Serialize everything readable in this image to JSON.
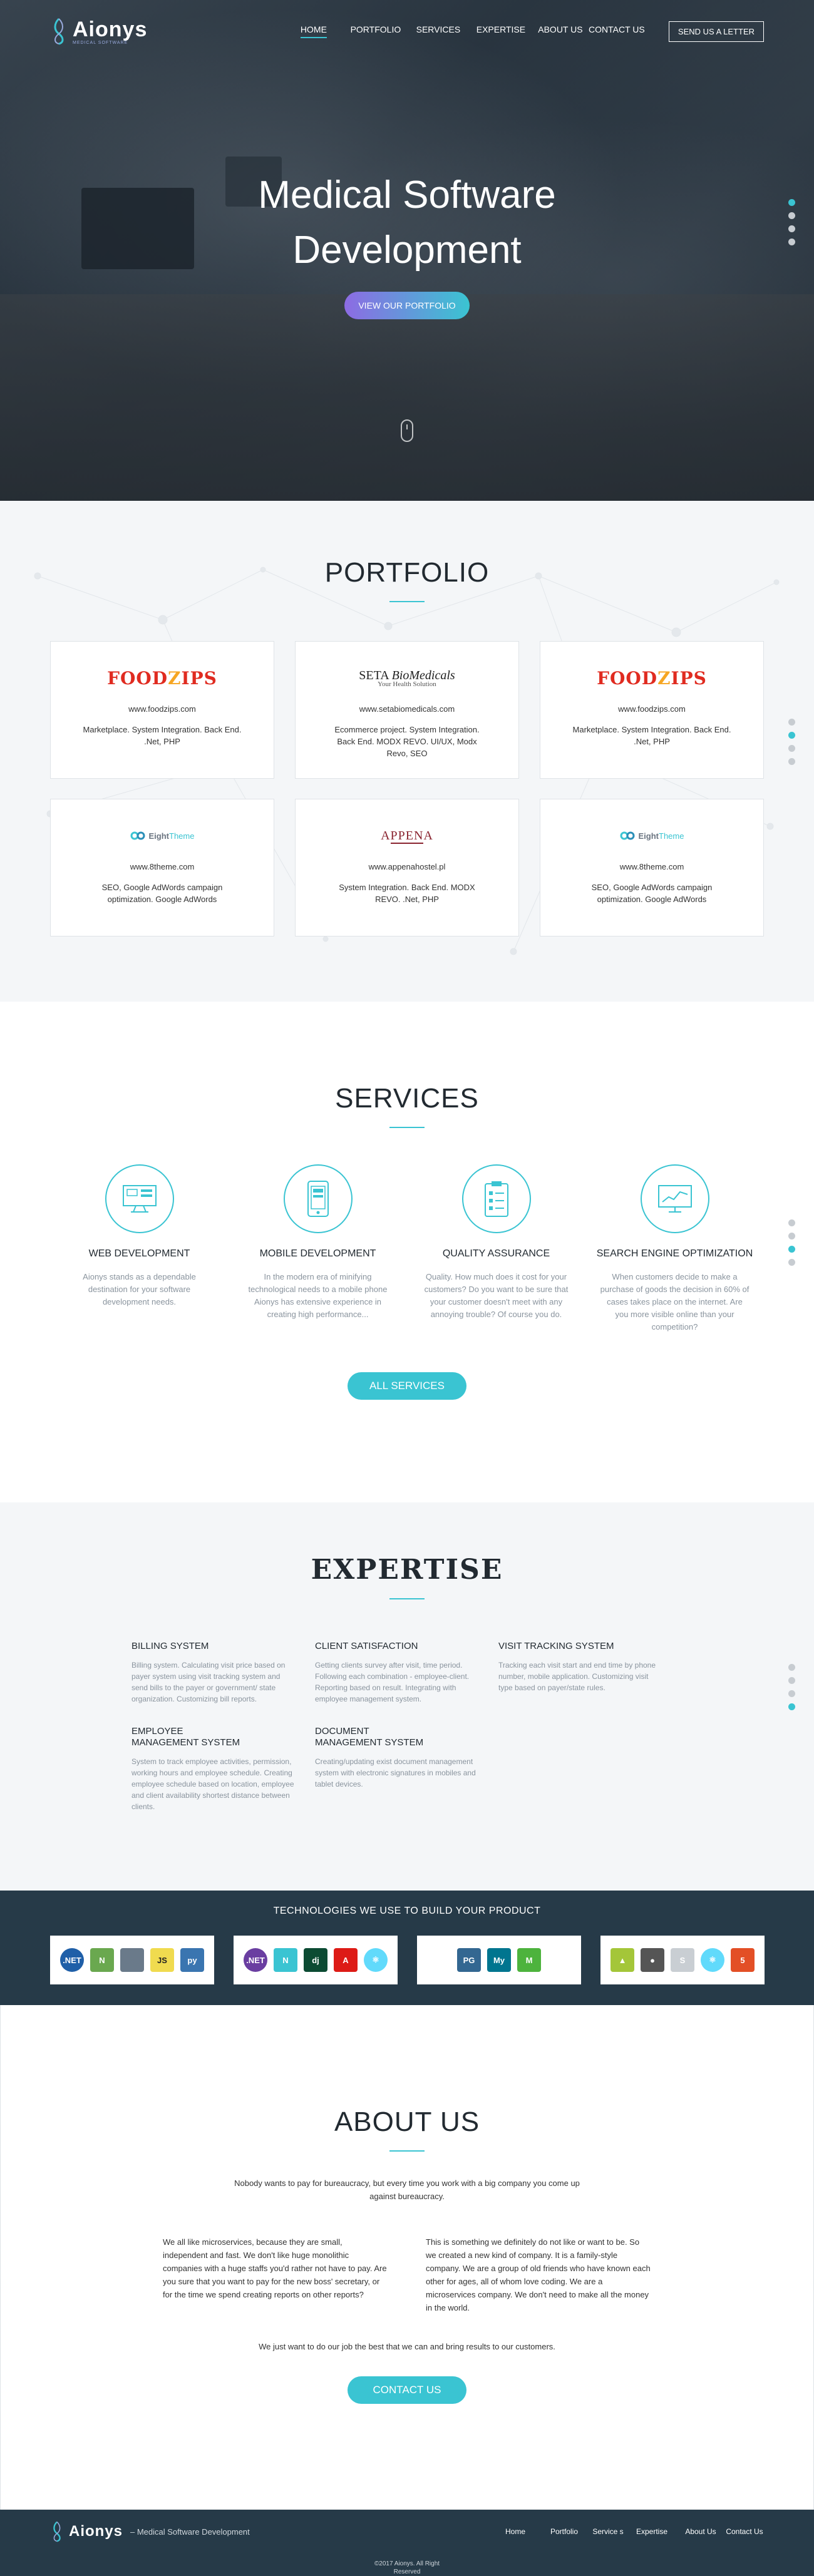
{
  "brand": {
    "name": "Aionys",
    "tagline": "MEDICAL SOFTWARE"
  },
  "nav": {
    "items": [
      {
        "label": "HOME"
      },
      {
        "label": "PORTFOLIO"
      },
      {
        "label": "SERVICES"
      },
      {
        "label": "EXPERTISE"
      },
      {
        "label": "ABOUT US"
      },
      {
        "label": "CONTACT US"
      }
    ],
    "cta": "SEND US A LETTER"
  },
  "hero": {
    "title_line1": "Medical Software",
    "title_line2": "Development",
    "button": "VIEW OUR PORTFOLIO"
  },
  "portfolio": {
    "title": "PORTFOLIO",
    "cards": [
      {
        "logo": "FOODZIPS",
        "url": "www.foodzips.com",
        "desc": "Marketplace. System Integration. Back End. .Net, PHP"
      },
      {
        "logo": "SETA BioMedicals",
        "url": "www.setabiomedicals.com",
        "desc": "Ecommerce project. System Integration. Back End. MODX REVO. UI/UX, Modx Revo, SEO"
      },
      {
        "logo": "FOODZIPS",
        "url": "www.foodzips.com",
        "desc": "Marketplace. System Integration. Back End. .Net, PHP"
      },
      {
        "logo": "EightTheme",
        "url": "www.8theme.com",
        "desc": "SEO, Google AdWords campaign optimization. Google AdWords"
      },
      {
        "logo": "APPENA",
        "url": "www.appenahostel.pl",
        "desc": "System Integration. Back End. MODX REVO. .Net, PHP"
      },
      {
        "logo": "EightTheme",
        "url": "www.8theme.com",
        "desc": "SEO, Google AdWords campaign optimization. Google AdWords"
      }
    ]
  },
  "services": {
    "title": "SERVICES",
    "items": [
      {
        "name": "WEB DEVELOPMENT",
        "icon": "web-monitor-icon",
        "desc": "Aionys stands as a dependable destination for your software development needs."
      },
      {
        "name": "MOBILE DEVELOPMENT",
        "icon": "mobile-phone-icon",
        "desc": "In the modern era of minifying technological needs to a mobile phone Aionys has extensive experience in creating high performance..."
      },
      {
        "name": "QUALITY ASSURANCE",
        "icon": "clipboard-checklist-icon",
        "desc": "Quality. How much does it cost for your customers? Do you want to be sure that your customer doesn't meet with any annoying trouble? Of course you do."
      },
      {
        "name": "SEARCH ENGINE OPTIMIZATION",
        "icon": "analytics-chart-icon",
        "desc": "When customers decide to make a purchase of goods the decision in 60% of cases takes place on the internet. Are you more visible online than your competition?"
      }
    ],
    "button": "ALL SERVICES"
  },
  "expertise": {
    "title": "EXPERTISE",
    "items": [
      {
        "name": "BILLING SYSTEM",
        "desc": "Billing system. Calculating visit price based on payer system using visit tracking system and send bills to the payer or government/ state organization. Customizing bill reports."
      },
      {
        "name": "CLIENT SATISFACTION",
        "desc": "Getting clients survey after visit, time period. Following each combination - employee-client. Reporting based on result. Integrating with employee management system."
      },
      {
        "name": "VISIT TRACKING SYSTEM",
        "desc": "Tracking each visit start and end time by phone number, mobile application. Customizing visit type based on payer/state rules."
      },
      {
        "name": "EMPLOYEE MANAGEMENT SYSTEM",
        "desc": "System to track employee activities, permission, working hours and employee schedule. Creating employee schedule based on location, employee and client availability shortest distance between clients."
      },
      {
        "name": "DOCUMENT MANAGEMENT SYSTEM",
        "desc": "Creating/updating exist document management system with electronic signatures in mobiles and tablet devices."
      }
    ]
  },
  "technologies": {
    "title": "TECHNOLOGIES WE USE TO BUILD YOUR PRODUCT",
    "groups": [
      [
        {
          "icon": "dotnet-icon",
          "label": ".NET",
          "color": "#1f5fa8"
        },
        {
          "icon": "nodejs-icon",
          "label": "N",
          "color": "#6aa84f"
        },
        {
          "icon": "server-icon",
          "label": "",
          "color": "#6a7a8a"
        },
        {
          "icon": "javascript-icon",
          "label": "JS",
          "color": "#f0db4f"
        },
        {
          "icon": "python-icon",
          "label": "py",
          "color": "#3a75b0"
        }
      ],
      [
        {
          "icon": "dotnet-icon",
          "label": ".NET",
          "color": "#6a3ea1"
        },
        {
          "icon": "nativescript-icon",
          "label": "N",
          "color": "#3ac4d2"
        },
        {
          "icon": "django-icon",
          "label": "dj",
          "color": "#0c4b33"
        },
        {
          "icon": "angular-icon",
          "label": "A",
          "color": "#dd1b16"
        },
        {
          "icon": "react-icon",
          "label": "⚛",
          "color": "#61dafb"
        }
      ],
      [
        {
          "icon": "postgresql-icon",
          "label": "PG",
          "color": "#336791"
        },
        {
          "icon": "mysql-icon",
          "label": "My",
          "color": "#00758f"
        },
        {
          "icon": "mongodb-icon",
          "label": "M",
          "color": "#4db33d"
        }
      ],
      [
        {
          "icon": "android-icon",
          "label": "▲",
          "color": "#a4c639"
        },
        {
          "icon": "apple-icon",
          "label": "●",
          "color": "#555555"
        },
        {
          "icon": "swift-icon",
          "label": "S",
          "color": "#c9ced3"
        },
        {
          "icon": "react-native-icon",
          "label": "⚛",
          "color": "#61dafb"
        },
        {
          "icon": "html5-icon",
          "label": "5",
          "color": "#e34f26"
        }
      ]
    ]
  },
  "about": {
    "title": "ABOUT US",
    "lead": "Nobody wants to pay for bureaucracy, but every time you work with a big company you come up against bureaucracy.",
    "col1": "We all like microservices, because they are small, independent and fast. We don't like huge monolithic companies with a huge staffs you'd rather not have to pay. Are you sure that you want to pay for the new boss' secretary, or for the time we spend creating reports on other reports?",
    "col2": "This is something we definitely do not like or want to be. So we created a new kind of company. It is a family-style company. We are a group of old friends who have known each other for ages, all of whom love coding. We are a microservices company. We don't need to make all the money in the world.",
    "closing": "We just want to do our job the best that we can and bring results to our customers.",
    "button": "CONTACT US"
  },
  "footer": {
    "tagline": "– Medical Software Development",
    "links": [
      {
        "label": "Home"
      },
      {
        "label": "Portfolio"
      },
      {
        "label": "Service s"
      },
      {
        "label": "Expertise"
      },
      {
        "label": "About Us"
      },
      {
        "label": "Contact Us"
      }
    ],
    "copyright_line1": "©2017 Aionys. All Right",
    "copyright_line2": "Reserved"
  },
  "colors": {
    "accent": "#3ac4d2",
    "dark": "#263a48",
    "hero_gradient_start": "#8d6be3"
  }
}
